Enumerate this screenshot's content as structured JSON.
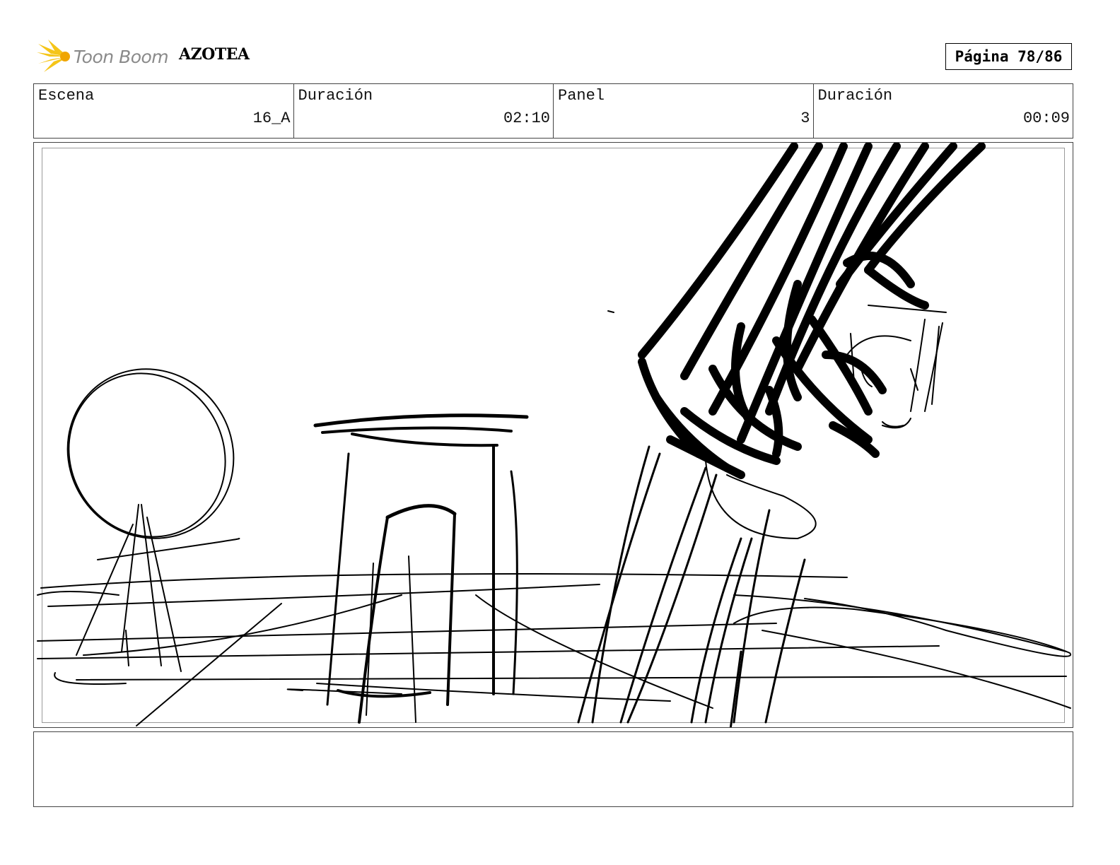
{
  "header": {
    "logo_text": "Toon Boom",
    "project_title": "AZOTEA",
    "page_label": "Página 78/86"
  },
  "info": [
    {
      "label": "Escena",
      "value": "16_A"
    },
    {
      "label": "Duración",
      "value": "02:10"
    },
    {
      "label": "Panel",
      "value": "3"
    },
    {
      "label": "Duración",
      "value": "00:09"
    }
  ],
  "notes": {
    "text": ""
  },
  "colors": {
    "logo_accent": "#f5c518",
    "logo_text": "#8a8a8a",
    "ink": "#000000"
  }
}
